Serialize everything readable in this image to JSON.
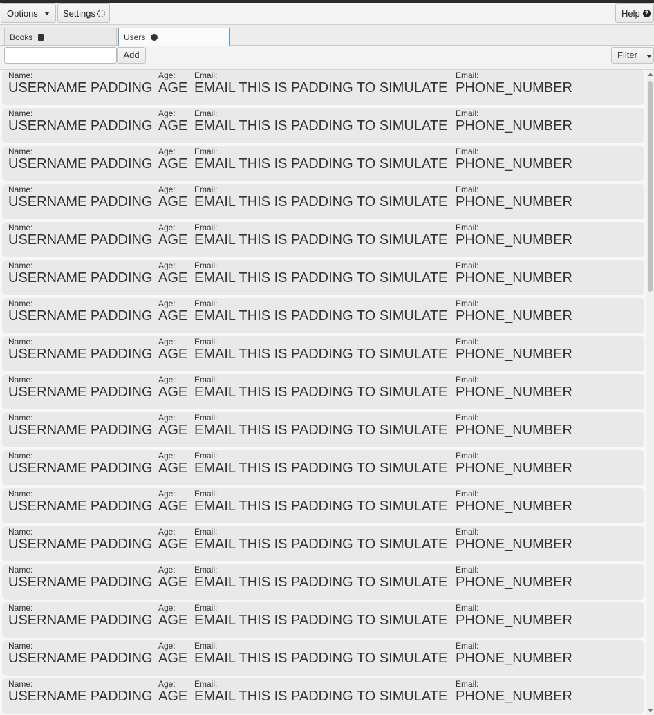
{
  "toolbar": {
    "options_label": "Options",
    "settings_label": "Settings",
    "help_label": "Help"
  },
  "tabs": [
    {
      "label": "Books",
      "icon": "book-icon",
      "active": false
    },
    {
      "label": "Users",
      "icon": "user-icon",
      "active": true
    }
  ],
  "addbar": {
    "input_value": "",
    "add_label": "Add",
    "filter_label": "Filter"
  },
  "list": {
    "rows": [
      {
        "name_label": "Name:",
        "name": "USERNAME PADDING",
        "age_label": "Age:",
        "age": "AGE",
        "email_label": "Email:",
        "email": "EMAIL THIS IS PADDING TO SIMULATE",
        "phone_label": "Email:",
        "phone": "PHONE_NUMBER"
      },
      {
        "name_label": "Name:",
        "name": "USERNAME PADDING",
        "age_label": "Age:",
        "age": "AGE",
        "email_label": "Email:",
        "email": "EMAIL THIS IS PADDING TO SIMULATE",
        "phone_label": "Email:",
        "phone": "PHONE_NUMBER"
      },
      {
        "name_label": "Name:",
        "name": "USERNAME PADDING",
        "age_label": "Age:",
        "age": "AGE",
        "email_label": "Email:",
        "email": "EMAIL THIS IS PADDING TO SIMULATE",
        "phone_label": "Email:",
        "phone": "PHONE_NUMBER"
      },
      {
        "name_label": "Name:",
        "name": "USERNAME PADDING",
        "age_label": "Age:",
        "age": "AGE",
        "email_label": "Email:",
        "email": "EMAIL THIS IS PADDING TO SIMULATE",
        "phone_label": "Email:",
        "phone": "PHONE_NUMBER"
      },
      {
        "name_label": "Name:",
        "name": "USERNAME PADDING",
        "age_label": "Age:",
        "age": "AGE",
        "email_label": "Email:",
        "email": "EMAIL THIS IS PADDING TO SIMULATE",
        "phone_label": "Email:",
        "phone": "PHONE_NUMBER"
      },
      {
        "name_label": "Name:",
        "name": "USERNAME PADDING",
        "age_label": "Age:",
        "age": "AGE",
        "email_label": "Email:",
        "email": "EMAIL THIS IS PADDING TO SIMULATE",
        "phone_label": "Email:",
        "phone": "PHONE_NUMBER"
      },
      {
        "name_label": "Name:",
        "name": "USERNAME PADDING",
        "age_label": "Age:",
        "age": "AGE",
        "email_label": "Email:",
        "email": "EMAIL THIS IS PADDING TO SIMULATE",
        "phone_label": "Email:",
        "phone": "PHONE_NUMBER"
      },
      {
        "name_label": "Name:",
        "name": "USERNAME PADDING",
        "age_label": "Age:",
        "age": "AGE",
        "email_label": "Email:",
        "email": "EMAIL THIS IS PADDING TO SIMULATE",
        "phone_label": "Email:",
        "phone": "PHONE_NUMBER"
      },
      {
        "name_label": "Name:",
        "name": "USERNAME PADDING",
        "age_label": "Age:",
        "age": "AGE",
        "email_label": "Email:",
        "email": "EMAIL THIS IS PADDING TO SIMULATE",
        "phone_label": "Email:",
        "phone": "PHONE_NUMBER"
      },
      {
        "name_label": "Name:",
        "name": "USERNAME PADDING",
        "age_label": "Age:",
        "age": "AGE",
        "email_label": "Email:",
        "email": "EMAIL THIS IS PADDING TO SIMULATE",
        "phone_label": "Email:",
        "phone": "PHONE_NUMBER"
      },
      {
        "name_label": "Name:",
        "name": "USERNAME PADDING",
        "age_label": "Age:",
        "age": "AGE",
        "email_label": "Email:",
        "email": "EMAIL THIS IS PADDING TO SIMULATE",
        "phone_label": "Email:",
        "phone": "PHONE_NUMBER"
      },
      {
        "name_label": "Name:",
        "name": "USERNAME PADDING",
        "age_label": "Age:",
        "age": "AGE",
        "email_label": "Email:",
        "email": "EMAIL THIS IS PADDING TO SIMULATE",
        "phone_label": "Email:",
        "phone": "PHONE_NUMBER"
      },
      {
        "name_label": "Name:",
        "name": "USERNAME PADDING",
        "age_label": "Age:",
        "age": "AGE",
        "email_label": "Email:",
        "email": "EMAIL THIS IS PADDING TO SIMULATE",
        "phone_label": "Email:",
        "phone": "PHONE_NUMBER"
      },
      {
        "name_label": "Name:",
        "name": "USERNAME PADDING",
        "age_label": "Age:",
        "age": "AGE",
        "email_label": "Email:",
        "email": "EMAIL THIS IS PADDING TO SIMULATE",
        "phone_label": "Email:",
        "phone": "PHONE_NUMBER"
      },
      {
        "name_label": "Name:",
        "name": "USERNAME PADDING",
        "age_label": "Age:",
        "age": "AGE",
        "email_label": "Email:",
        "email": "EMAIL THIS IS PADDING TO SIMULATE",
        "phone_label": "Email:",
        "phone": "PHONE_NUMBER"
      },
      {
        "name_label": "Name:",
        "name": "USERNAME PADDING",
        "age_label": "Age:",
        "age": "AGE",
        "email_label": "Email:",
        "email": "EMAIL THIS IS PADDING TO SIMULATE",
        "phone_label": "Email:",
        "phone": "PHONE_NUMBER"
      },
      {
        "name_label": "Name:",
        "name": "USERNAME PADDING",
        "age_label": "Age:",
        "age": "AGE",
        "email_label": "Email:",
        "email": "EMAIL THIS IS PADDING TO SIMULATE",
        "phone_label": "Email:",
        "phone": "PHONE_NUMBER"
      }
    ]
  }
}
